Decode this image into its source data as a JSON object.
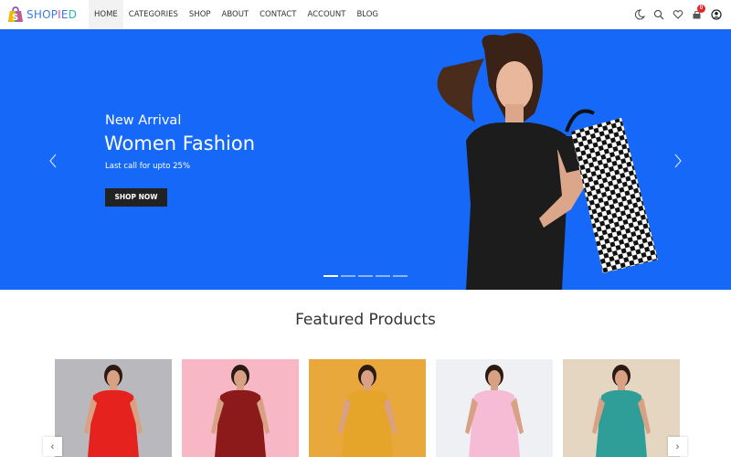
{
  "brand": {
    "name_letters": [
      "S",
      "H",
      "O",
      "P",
      "I",
      "E",
      "D"
    ],
    "name_colors": [
      "#3a7de0",
      "#3a7de0",
      "#3a7de0",
      "#3a7de0",
      "#e84393",
      "#3a7de0",
      "#2bb5a6"
    ],
    "icon": "shopping-bag-logo-icon"
  },
  "nav": {
    "items": [
      {
        "label": "HOME",
        "active": true
      },
      {
        "label": "CATEGORIES",
        "active": false
      },
      {
        "label": "SHOP",
        "active": false
      },
      {
        "label": "ABOUT",
        "active": false
      },
      {
        "label": "CONTACT",
        "active": false
      },
      {
        "label": "ACCOUNT",
        "active": false
      },
      {
        "label": "BLOG",
        "active": false
      }
    ]
  },
  "header_icons": {
    "items": [
      "moon-icon",
      "search-icon",
      "heart-icon",
      "cart-icon",
      "user-icon"
    ],
    "cart_count": "0"
  },
  "hero": {
    "subtitle": "New Arrival",
    "title": "Women Fashion",
    "description": "Last call for upto 25%",
    "button_label": "SHOP NOW",
    "slide_count": 5,
    "active_slide": 1,
    "background_color": "#1669f8"
  },
  "featured": {
    "title": "Featured Products",
    "products": [
      {
        "name": "red-anarkali-dress",
        "bg": "#b8b8bd",
        "dress": "#e6221e"
      },
      {
        "name": "floral-kurta-dupatta-set",
        "bg": "#f7b7c4",
        "dress": "#8c1a1a"
      },
      {
        "name": "yellow-printed-kurta",
        "bg": "#e9a83b",
        "dress": "#e5a52a"
      },
      {
        "name": "pink-straight-kurta",
        "bg": "#eef0f4",
        "dress": "#f6bcd6"
      },
      {
        "name": "teal-printed-suit",
        "bg": "#e4d6c1",
        "dress": "#2f9e98"
      }
    ]
  }
}
